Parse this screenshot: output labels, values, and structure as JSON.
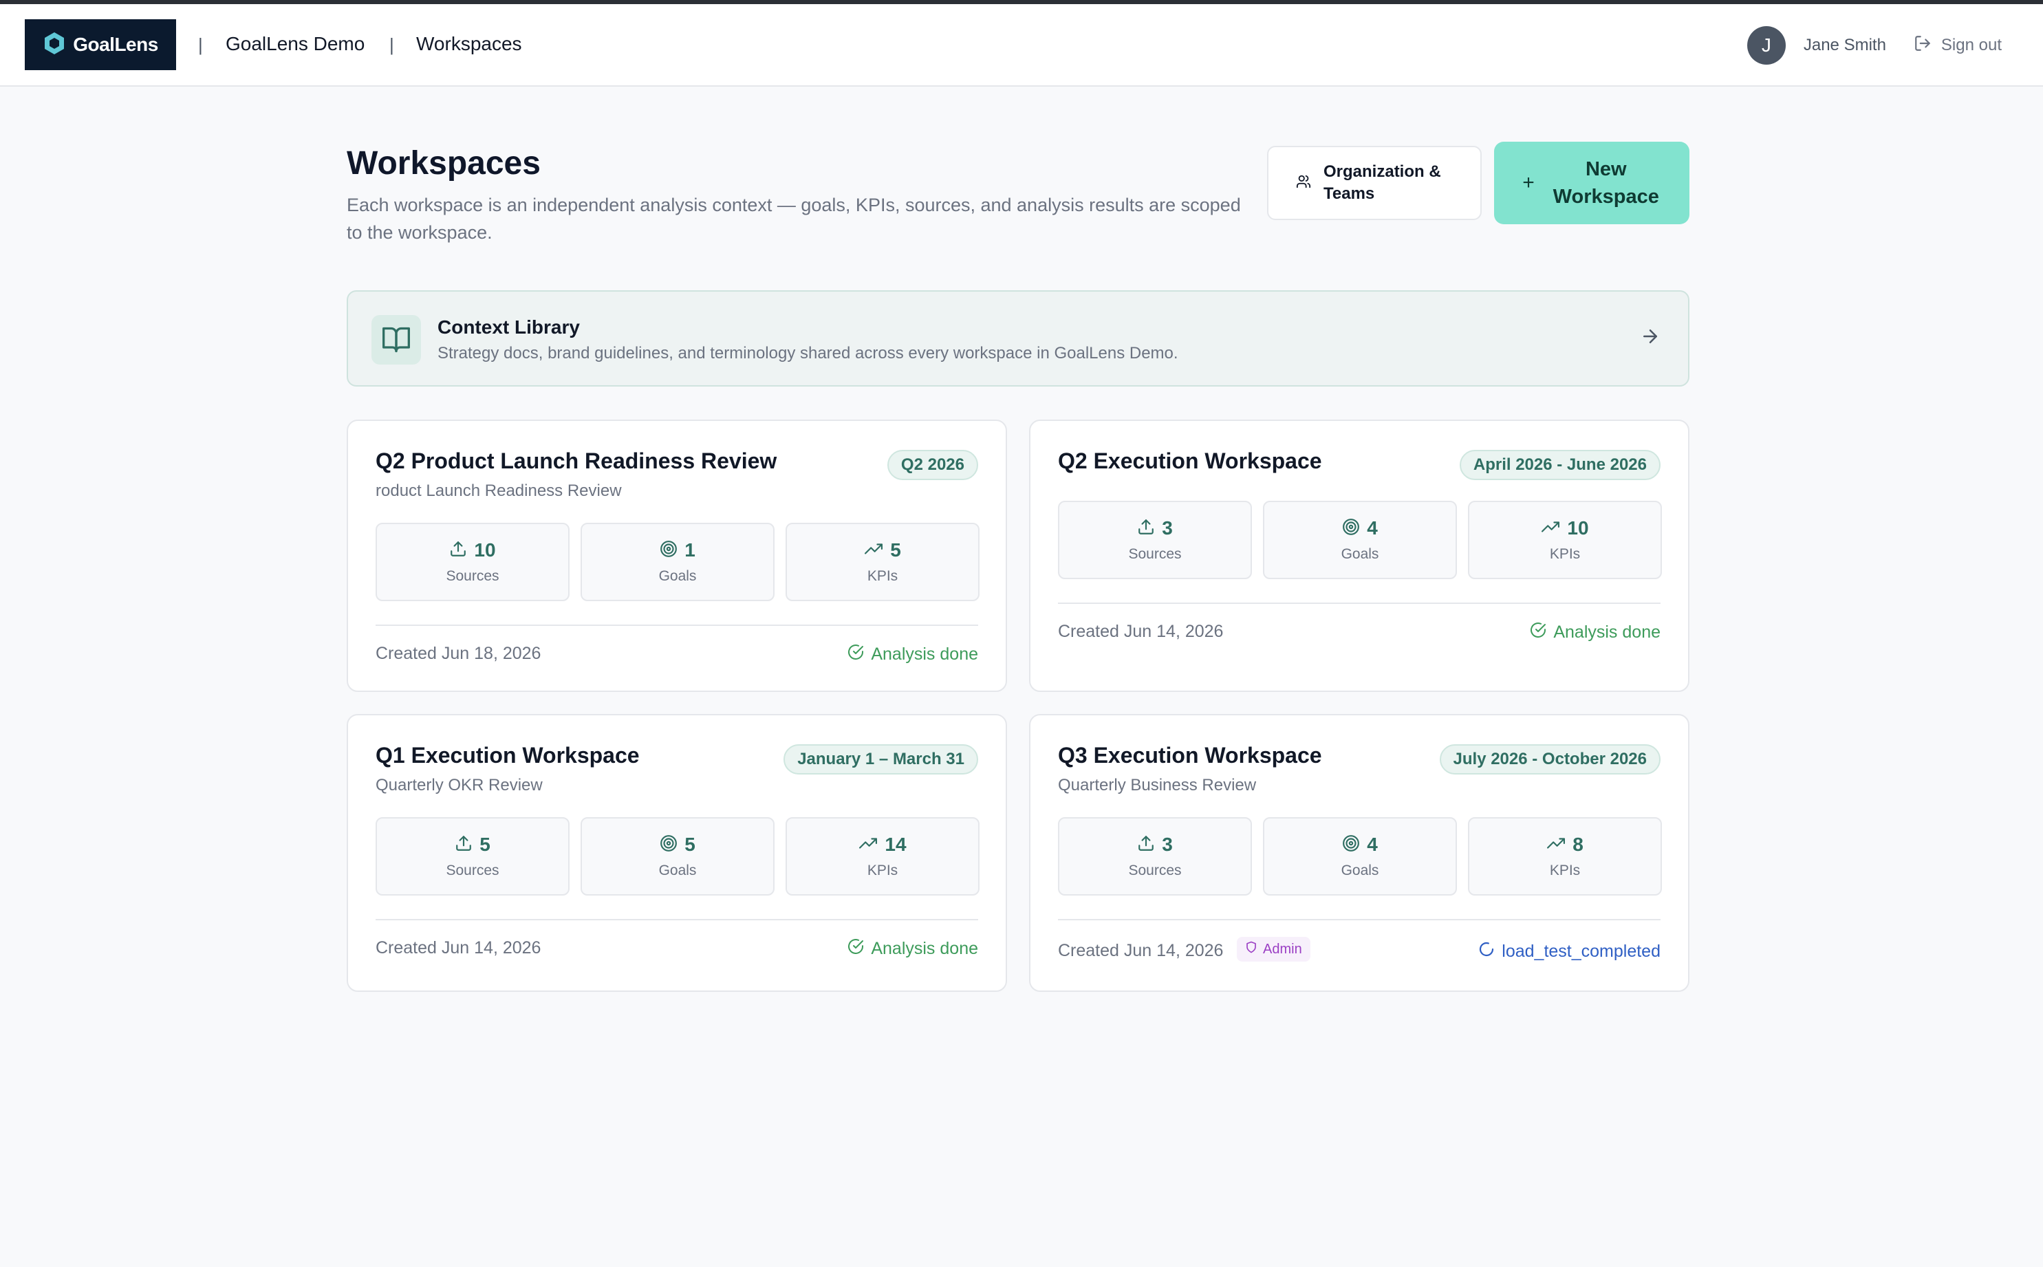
{
  "header": {
    "logo_text": "GoalLens",
    "org_name": "GoalLens Demo",
    "section": "Workspaces",
    "separator": "|",
    "user_initial": "J",
    "user_name": "Jane Smith",
    "signout_label": "Sign out"
  },
  "page": {
    "title": "Workspaces",
    "description": "Each workspace is an independent analysis context — goals, KPIs, sources, and analysis results are scoped to the workspace.",
    "org_button_label": "Organization & Teams",
    "new_button_label": "New Workspace"
  },
  "context_library": {
    "title": "Context Library",
    "description": "Strategy docs, brand guidelines, and terminology shared across every workspace in GoalLens Demo."
  },
  "stat_labels": {
    "sources": "Sources",
    "goals": "Goals",
    "kpis": "KPIs"
  },
  "workspaces": [
    {
      "title": "Q2 Product Launch Readiness Review",
      "subtitle": "roduct Launch Readiness Review",
      "period": "Q2 2026",
      "sources": "10",
      "goals": "1",
      "kpis": "5",
      "created": "Created Jun 18, 2026",
      "status": "Analysis done"
    },
    {
      "title": "Q2 Execution Workspace",
      "subtitle": "",
      "period": "April 2026 - June 2026",
      "sources": "3",
      "goals": "4",
      "kpis": "10",
      "created": "Created Jun 14, 2026",
      "status": "Analysis done"
    },
    {
      "title": "Q1 Execution Workspace",
      "subtitle": "Quarterly OKR Review",
      "period": "January 1 – March 31",
      "sources": "5",
      "goals": "5",
      "kpis": "14",
      "created": "Created Jun 14, 2026",
      "status": "Analysis done"
    },
    {
      "title": "Q3 Execution Workspace",
      "subtitle": "Quarterly Business Review",
      "period": "July 2026 - October 2026",
      "sources": "3",
      "goals": "4",
      "kpis": "8",
      "created": "Created Jun 14, 2026",
      "role_badge": "Admin",
      "status": "load_test_completed"
    }
  ],
  "colors": {
    "accent": "#82e3cf",
    "logo_bg": "#0b1a2e",
    "stat_text": "#2f6e62",
    "status_done": "#3d9b5a",
    "status_loading": "#2f5fc4",
    "admin_badge": "#9b3fc4"
  },
  "icons": {
    "logo": "hexagon-logo-icon",
    "org_button": "users-icon",
    "new_button": "plus-icon",
    "context_library": "book-open-icon",
    "context_arrow": "arrow-right-icon",
    "sources": "upload-icon",
    "goals": "target-icon",
    "kpis": "trending-up-icon",
    "done": "check-circle-icon",
    "loading": "loader-icon",
    "admin": "shield-icon",
    "signout": "log-out-icon"
  }
}
